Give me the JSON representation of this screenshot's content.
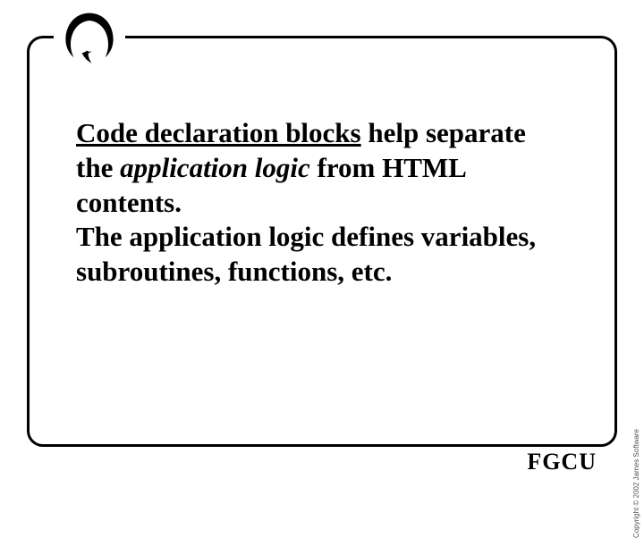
{
  "content": {
    "underlined": "Code declaration blocks",
    "after_underlined": " help separate the ",
    "italic": "application logic",
    "after_italic": " from HTML contents.",
    "line2": "The application logic defines variables, subroutines, functions, etc."
  },
  "footer": {
    "logo_text": "FGCU"
  },
  "copyright": "Copyright © 2002 James Software"
}
